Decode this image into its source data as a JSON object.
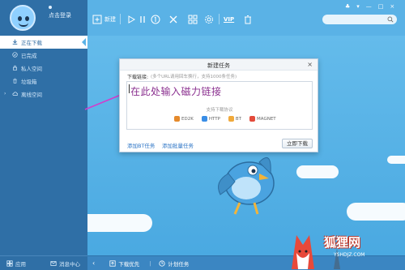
{
  "app": {
    "accent": "#2f6fa6",
    "background": "#5ab2e6"
  },
  "profile": {
    "login_label": "点击登录"
  },
  "sidebar": {
    "items": [
      {
        "label": "正在下载",
        "icon": "download-icon",
        "active": true
      },
      {
        "label": "已完成",
        "icon": "check-circle-icon",
        "active": false
      },
      {
        "label": "私人空间",
        "icon": "lock-icon",
        "active": false
      },
      {
        "label": "垃圾箱",
        "icon": "trash-icon",
        "active": false
      },
      {
        "label": "离线空间",
        "icon": "cloud-icon",
        "active": false,
        "expandable": true
      }
    ],
    "bottom": [
      {
        "label": "应用",
        "icon": "apps-icon"
      },
      {
        "label": "消息中心",
        "icon": "message-icon"
      }
    ]
  },
  "toolbar": {
    "new_label": "新建",
    "icons": [
      "plus-icon",
      "play-icon",
      "pause-icon",
      "delete-icon",
      "grid-icon",
      "settings-icon",
      "vip-icon",
      "trash-icon"
    ],
    "vip_label": "VIP"
  },
  "dialog": {
    "title": "新建任务",
    "close": "×",
    "link_label": "下载链接:",
    "hint": "(多个URL请用回车换行，支持1000条任务)",
    "input_value": "在此处输入磁力链接",
    "protocol_title": "支持下载协议",
    "protocols": [
      {
        "name": "ED2K",
        "color": "#e58a2c"
      },
      {
        "name": "HTTP",
        "color": "#3a8ee6"
      },
      {
        "name": "BT",
        "color": "#f0a93b"
      },
      {
        "name": "MAGNET",
        "color": "#e34b3b"
      }
    ],
    "add_bt_label": "添加BT任务",
    "batch_label": "添加批量任务",
    "download_now_label": "立即下载"
  },
  "status_bar": {
    "priority_label": "下载优先",
    "schedule_label": "计划任务"
  },
  "watermark": {
    "text": "狐狸网",
    "url": "YSHDJZ.COM"
  }
}
